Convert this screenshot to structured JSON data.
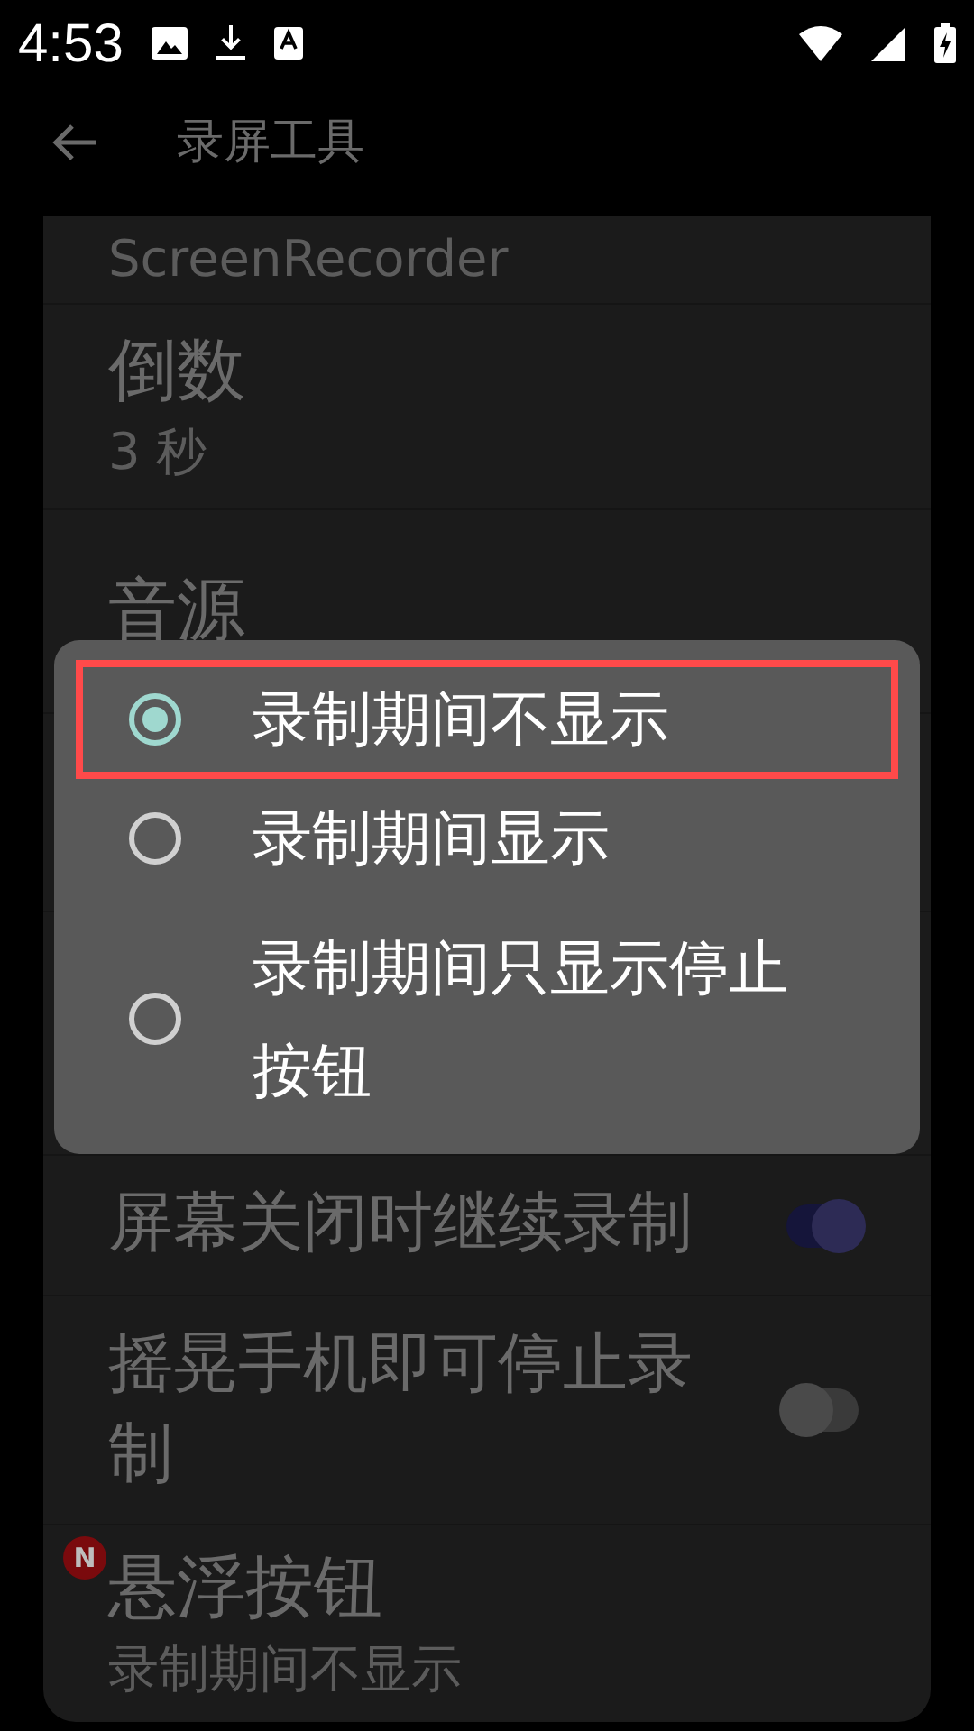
{
  "status_bar": {
    "time": "4:53"
  },
  "toolbar": {
    "title": "录屏工具"
  },
  "settings": [
    {
      "kind": "text",
      "subtitle": "ScreenRecorder"
    },
    {
      "kind": "text",
      "title": "倒数",
      "subtitle": "3 秒"
    },
    {
      "kind": "text",
      "title": "音源"
    },
    {
      "kind": "blank"
    },
    {
      "kind": "blank"
    },
    {
      "kind": "switch",
      "title": "屏幕关闭时继续录制",
      "on": true
    },
    {
      "kind": "switch",
      "title": "摇晃手机即可停止录制",
      "on": false
    },
    {
      "kind": "text",
      "title": "悬浮按钮",
      "subtitle": "录制期间不显示",
      "badge": "N"
    }
  ],
  "dialog": {
    "options": [
      {
        "label": "录制期间不显示",
        "selected": true,
        "highlighted": true
      },
      {
        "label": "录制期间显示",
        "selected": false,
        "highlighted": false
      },
      {
        "label": "录制期间只显示停止按钮",
        "selected": false,
        "highlighted": false
      }
    ]
  }
}
